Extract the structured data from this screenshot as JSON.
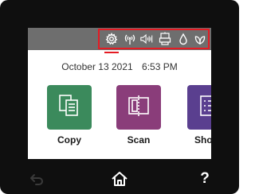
{
  "status_bar": {
    "icons": [
      "settings-icon",
      "wireless-icon",
      "sound-icon",
      "network-icon",
      "ink-icon",
      "eco-icon"
    ],
    "highlight_color": "#e41b23"
  },
  "datetime": {
    "date": "October 13 2021",
    "time": "6:53 PM"
  },
  "apps": [
    {
      "label": "Copy",
      "color": "#3b8a5c",
      "icon": "copy-icon"
    },
    {
      "label": "Scan",
      "color": "#8a3d7a",
      "icon": "scan-icon"
    },
    {
      "label": "Short",
      "color": "#5a3f8f",
      "icon": "shortcuts-icon"
    }
  ],
  "nav": {
    "back_icon": "back-icon",
    "home_icon": "home-icon",
    "help_label": "?"
  }
}
